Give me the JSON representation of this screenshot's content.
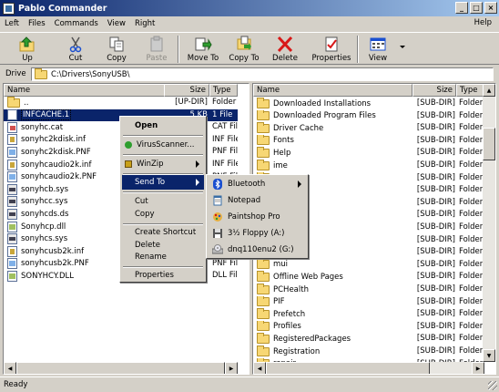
{
  "window": {
    "title": "Pablo Commander",
    "min": "_",
    "max": "□",
    "close": "×"
  },
  "menu": {
    "items": [
      "Left",
      "Files",
      "Commands",
      "View",
      "Right"
    ],
    "help": "Help"
  },
  "toolbar": {
    "up": "Up",
    "cut": "Cut",
    "copy": "Copy",
    "paste": "Paste",
    "move_to": "Move To",
    "copy_to": "Copy To",
    "delete": "Delete",
    "properties": "Properties",
    "view": "View"
  },
  "drive": {
    "label": "Drive",
    "path": "C:\\Drivers\\SonyUSB\\"
  },
  "left": {
    "headers": {
      "name": "Name",
      "size": "Size",
      "type": "Type"
    },
    "rows": [
      {
        "name": "..",
        "size": "[UP-DIR]",
        "type": "Folder",
        "icon": "up"
      },
      {
        "name": "INFCACHE.1",
        "size": "5 KB",
        "type": "1 File",
        "icon": "file"
      },
      {
        "name": "sonyhc.cat",
        "size": "",
        "type": "CAT File",
        "icon": "cat"
      },
      {
        "name": "sonyhc2kdisk.inf",
        "size": "",
        "type": "INF File",
        "icon": "inf"
      },
      {
        "name": "sonyhc2kdisk.PNF",
        "size": "",
        "type": "PNF File",
        "icon": "png"
      },
      {
        "name": "sonyhcaudio2k.inf",
        "size": "",
        "type": "INF File",
        "icon": "inf"
      },
      {
        "name": "sonyhcaudio2k.PNF",
        "size": "",
        "type": "PNF File",
        "icon": "png"
      },
      {
        "name": "sonyhcb.sys",
        "size": "",
        "type": "SYS File",
        "icon": "sys"
      },
      {
        "name": "sonyhcc.sys",
        "size": "",
        "type": "SYS File",
        "icon": "sys"
      },
      {
        "name": "sonyhcds.ds",
        "size": "",
        "type": "DS File",
        "icon": "sys"
      },
      {
        "name": "Sonyhcp.dll",
        "size": "",
        "type": "DLL File",
        "icon": "dll"
      },
      {
        "name": "sonyhcs.sys",
        "size": "",
        "type": "SYS File",
        "icon": "sys"
      },
      {
        "name": "sonyhcusb2k.inf",
        "size": "",
        "type": "INF File",
        "icon": "inf"
      },
      {
        "name": "sonyhcusb2k.PNF",
        "size": "",
        "type": "PNF File",
        "icon": "png"
      },
      {
        "name": "SONYHCY.DLL",
        "size": "",
        "type": "DLL File",
        "icon": "dll"
      }
    ]
  },
  "right": {
    "headers": {
      "name": "Name",
      "size": "Size",
      "type": "Type"
    },
    "rows": [
      {
        "name": "Downloaded Installations",
        "size": "[SUB-DIR]",
        "type": "Folder"
      },
      {
        "name": "Downloaded Program Files",
        "size": "[SUB-DIR]",
        "type": "Folder"
      },
      {
        "name": "Driver Cache",
        "size": "[SUB-DIR]",
        "type": "Folder"
      },
      {
        "name": "Fonts",
        "size": "[SUB-DIR]",
        "type": "Folder"
      },
      {
        "name": "Help",
        "size": "[SUB-DIR]",
        "type": "Folder"
      },
      {
        "name": "ime",
        "size": "[SUB-DIR]",
        "type": "Folder"
      },
      {
        "name": "",
        "size": "[SUB-DIR]",
        "type": "Folder"
      },
      {
        "name": "",
        "size": "[SUB-DIR]",
        "type": "Folder"
      },
      {
        "name": "",
        "size": "[SUB-DIR]",
        "type": "Folder"
      },
      {
        "name": "",
        "size": "[SUB-DIR]",
        "type": "Folder"
      },
      {
        "name": "",
        "size": "[SUB-DIR]",
        "type": "Folder"
      },
      {
        "name": "tmp",
        "size": "[SUB-DIR]",
        "type": "Folder"
      },
      {
        "name": "",
        "size": "[SUB-DIR]",
        "type": "Folder"
      },
      {
        "name": "mui",
        "size": "[SUB-DIR]",
        "type": "Folder"
      },
      {
        "name": "Offline Web Pages",
        "size": "[SUB-DIR]",
        "type": "Folder"
      },
      {
        "name": "PCHealth",
        "size": "[SUB-DIR]",
        "type": "Folder"
      },
      {
        "name": "PIF",
        "size": "[SUB-DIR]",
        "type": "Folder"
      },
      {
        "name": "Prefetch",
        "size": "[SUB-DIR]",
        "type": "Folder"
      },
      {
        "name": "Profiles",
        "size": "[SUB-DIR]",
        "type": "Folder"
      },
      {
        "name": "RegisteredPackages",
        "size": "[SUB-DIR]",
        "type": "Folder"
      },
      {
        "name": "Registration",
        "size": "[SUB-DIR]",
        "type": "Folder"
      },
      {
        "name": "repair",
        "size": "[SUB-DIR]",
        "type": "Folder"
      }
    ]
  },
  "context_menu": {
    "open": "Open",
    "virus_scanner": "VirusScanner...",
    "winzip": "WinZip",
    "send_to": "Send To",
    "cut": "Cut",
    "copy": "Copy",
    "create_shortcut": "Create Shortcut",
    "delete": "Delete",
    "rename": "Rename",
    "properties": "Properties"
  },
  "send_to_menu": {
    "bluetooth": "Bluetooth",
    "notepad": "Notepad",
    "paintshop": "Paintshop Pro",
    "floppy": "3½ Floppy (A:)",
    "drive_g": "dnq110enu2 (G:)"
  },
  "status": {
    "text": "Ready"
  },
  "colors": {
    "title_start": "#0a246a",
    "title_end": "#a6caf0",
    "selection": "#0a246a",
    "face": "#d4d0c8",
    "folder": "#f7d774"
  }
}
